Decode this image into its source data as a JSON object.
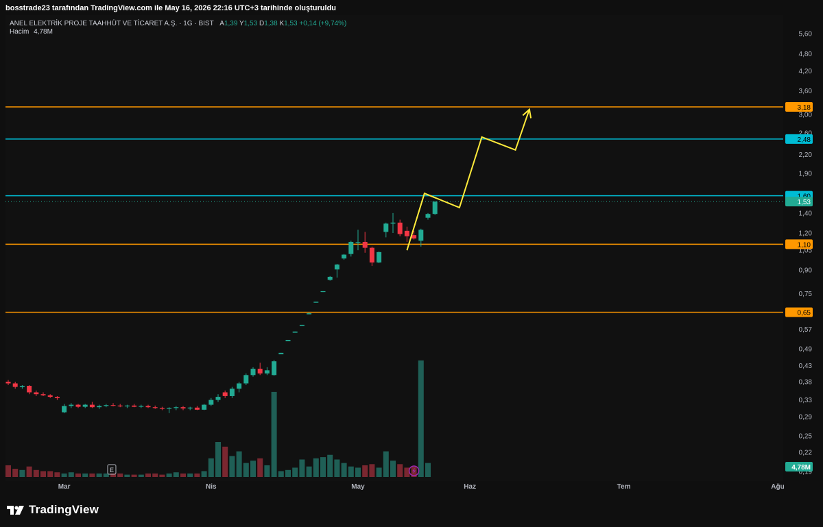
{
  "header": {
    "attribution": "bosstrade23 tarafından TradingView.com ile May 16, 2026 22:16 UTC+3 tarihinde oluşturuldu"
  },
  "legend": {
    "symbol": "ANEL ELEKTRİK PROJE TAAHHÜT VE TİCARET A.Ş. · 1G · BIST",
    "open_label": "A",
    "open": "1,39",
    "high_label": "Y",
    "high": "1,53",
    "low_label": "D",
    "low": "1,38",
    "close_label": "K",
    "close": "1,53",
    "change": "+0,14 (+9,74%)",
    "volume_label": "Hacim",
    "volume": "4,78M"
  },
  "branding": {
    "logo_text": "TradingView"
  },
  "colors": {
    "up": "#22ab94",
    "down": "#f23645",
    "orange": "#ff9800",
    "cyan": "#00bcd4",
    "path": "#ffeb3b",
    "vol_up": "#1f5f56",
    "vol_down": "#7a2730",
    "axis_text": "#b2b5be",
    "event_icon": "#9c27b0"
  },
  "chart_data": {
    "type": "candlestick",
    "symbol": "ANEL",
    "timeframe": "1G",
    "y_scale": "log",
    "ylim": [
      0.18,
      6.2
    ],
    "y_ticks": [
      "0,19",
      "0,22",
      "0,25",
      "0,29",
      "0,33",
      "0,38",
      "0,43",
      "0,49",
      "0,57",
      "0,65",
      "0,75",
      "0,90",
      "1,05",
      "1,20",
      "1,40",
      "1,60",
      "1,90",
      "2,20",
      "2,60",
      "3,00",
      "3,60",
      "4,20",
      "4,80",
      "5,60"
    ],
    "x_labels": [
      {
        "label": "Mar",
        "bar": 8
      },
      {
        "label": "Nis",
        "bar": 29
      },
      {
        "label": "May",
        "bar": 50
      },
      {
        "label": "Haz",
        "bar": 66
      },
      {
        "label": "Tem",
        "bar": 88
      },
      {
        "label": "Ağu",
        "bar": 110
      }
    ],
    "horizontal_levels": [
      {
        "value": 3.18,
        "label": "3,18",
        "color": "orange"
      },
      {
        "value": 2.48,
        "label": "2,48",
        "color": "cyan"
      },
      {
        "value": 1.6,
        "label": "1,60",
        "color": "cyan"
      },
      {
        "value": 1.1,
        "label": "1,10",
        "color": "orange"
      },
      {
        "value": 0.65,
        "label": "0,65",
        "color": "orange"
      }
    ],
    "last_price": {
      "value": 1.53,
      "label": "1,53"
    },
    "volume_badge": "4,78M",
    "candles": [
      {
        "o": 0.38,
        "h": 0.385,
        "l": 0.37,
        "c": 0.375
      },
      {
        "o": 0.375,
        "h": 0.38,
        "l": 0.36,
        "c": 0.365
      },
      {
        "o": 0.365,
        "h": 0.37,
        "l": 0.36,
        "c": 0.368
      },
      {
        "o": 0.368,
        "h": 0.37,
        "l": 0.345,
        "c": 0.35
      },
      {
        "o": 0.35,
        "h": 0.355,
        "l": 0.34,
        "c": 0.345
      },
      {
        "o": 0.345,
        "h": 0.35,
        "l": 0.34,
        "c": 0.342
      },
      {
        "o": 0.342,
        "h": 0.345,
        "l": 0.335,
        "c": 0.338
      },
      {
        "o": 0.338,
        "h": 0.34,
        "l": 0.33,
        "c": 0.335
      },
      {
        "o": 0.3,
        "h": 0.32,
        "l": 0.298,
        "c": 0.315
      },
      {
        "o": 0.315,
        "h": 0.322,
        "l": 0.31,
        "c": 0.318
      },
      {
        "o": 0.318,
        "h": 0.32,
        "l": 0.31,
        "c": 0.313
      },
      {
        "o": 0.313,
        "h": 0.32,
        "l": 0.31,
        "c": 0.318
      },
      {
        "o": 0.318,
        "h": 0.325,
        "l": 0.31,
        "c": 0.312
      },
      {
        "o": 0.312,
        "h": 0.318,
        "l": 0.308,
        "c": 0.315
      },
      {
        "o": 0.315,
        "h": 0.32,
        "l": 0.312,
        "c": 0.317
      },
      {
        "o": 0.317,
        "h": 0.322,
        "l": 0.314,
        "c": 0.316
      },
      {
        "o": 0.316,
        "h": 0.32,
        "l": 0.312,
        "c": 0.314
      },
      {
        "o": 0.314,
        "h": 0.318,
        "l": 0.31,
        "c": 0.316
      },
      {
        "o": 0.316,
        "h": 0.32,
        "l": 0.312,
        "c": 0.313
      },
      {
        "o": 0.313,
        "h": 0.318,
        "l": 0.31,
        "c": 0.315
      },
      {
        "o": 0.315,
        "h": 0.318,
        "l": 0.31,
        "c": 0.312
      },
      {
        "o": 0.312,
        "h": 0.316,
        "l": 0.308,
        "c": 0.31
      },
      {
        "o": 0.31,
        "h": 0.313,
        "l": 0.305,
        "c": 0.308
      },
      {
        "o": 0.308,
        "h": 0.312,
        "l": 0.298,
        "c": 0.31
      },
      {
        "o": 0.31,
        "h": 0.315,
        "l": 0.305,
        "c": 0.312
      },
      {
        "o": 0.312,
        "h": 0.315,
        "l": 0.305,
        "c": 0.309
      },
      {
        "o": 0.309,
        "h": 0.313,
        "l": 0.305,
        "c": 0.311
      },
      {
        "o": 0.311,
        "h": 0.315,
        "l": 0.305,
        "c": 0.306
      },
      {
        "o": 0.306,
        "h": 0.32,
        "l": 0.305,
        "c": 0.318
      },
      {
        "o": 0.318,
        "h": 0.335,
        "l": 0.315,
        "c": 0.33
      },
      {
        "o": 0.33,
        "h": 0.345,
        "l": 0.325,
        "c": 0.338
      },
      {
        "o": 0.35,
        "h": 0.355,
        "l": 0.335,
        "c": 0.34
      },
      {
        "o": 0.34,
        "h": 0.365,
        "l": 0.335,
        "c": 0.36
      },
      {
        "o": 0.36,
        "h": 0.38,
        "l": 0.35,
        "c": 0.375
      },
      {
        "o": 0.375,
        "h": 0.405,
        "l": 0.37,
        "c": 0.4
      },
      {
        "o": 0.4,
        "h": 0.425,
        "l": 0.395,
        "c": 0.42
      },
      {
        "o": 0.42,
        "h": 0.44,
        "l": 0.4,
        "c": 0.405
      },
      {
        "o": 0.405,
        "h": 0.425,
        "l": 0.4,
        "c": 0.415
      },
      {
        "o": 0.4,
        "h": 0.45,
        "l": 0.398,
        "c": 0.445
      },
      {
        "o": 0.47,
        "h": 0.475,
        "l": 0.47,
        "c": 0.475
      },
      {
        "o": 0.52,
        "h": 0.525,
        "l": 0.52,
        "c": 0.525
      },
      {
        "o": 0.555,
        "h": 0.56,
        "l": 0.555,
        "c": 0.56
      },
      {
        "o": 0.585,
        "h": 0.59,
        "l": 0.585,
        "c": 0.59
      },
      {
        "o": 0.64,
        "h": 0.65,
        "l": 0.64,
        "c": 0.645
      },
      {
        "o": 0.7,
        "h": 0.705,
        "l": 0.7,
        "c": 0.705
      },
      {
        "o": 0.76,
        "h": 0.765,
        "l": 0.76,
        "c": 0.765
      },
      {
        "o": 0.835,
        "h": 0.86,
        "l": 0.83,
        "c": 0.855
      },
      {
        "o": 0.905,
        "h": 0.945,
        "l": 0.85,
        "c": 0.94
      },
      {
        "o": 0.985,
        "h": 1.02,
        "l": 0.975,
        "c": 1.015
      },
      {
        "o": 1.02,
        "h": 1.13,
        "l": 1.0,
        "c": 1.12
      },
      {
        "o": 1.12,
        "h": 1.23,
        "l": 1.05,
        "c": 1.12
      },
      {
        "o": 1.12,
        "h": 1.21,
        "l": 1.03,
        "c": 1.07
      },
      {
        "o": 1.07,
        "h": 1.08,
        "l": 0.93,
        "c": 0.955
      },
      {
        "o": 0.955,
        "h": 1.04,
        "l": 0.95,
        "c": 1.035
      },
      {
        "o": 1.21,
        "h": 1.3,
        "l": 1.16,
        "c": 1.29
      },
      {
        "o": 1.29,
        "h": 1.4,
        "l": 1.2,
        "c": 1.3
      },
      {
        "o": 1.3,
        "h": 1.33,
        "l": 1.17,
        "c": 1.19
      },
      {
        "o": 1.22,
        "h": 1.26,
        "l": 1.12,
        "c": 1.17
      },
      {
        "o": 1.18,
        "h": 1.22,
        "l": 1.14,
        "c": 1.15
      },
      {
        "o": 1.13,
        "h": 1.24,
        "l": 1.08,
        "c": 1.23
      },
      {
        "o": 1.35,
        "h": 1.4,
        "l": 1.33,
        "c": 1.39
      },
      {
        "o": 1.39,
        "h": 1.53,
        "l": 1.38,
        "c": 1.53
      }
    ],
    "volume_relative": [
      0.1,
      0.07,
      0.06,
      0.09,
      0.06,
      0.05,
      0.05,
      0.04,
      0.03,
      0.04,
      0.03,
      0.03,
      0.03,
      0.03,
      0.03,
      0.03,
      0.03,
      0.02,
      0.02,
      0.02,
      0.03,
      0.03,
      0.02,
      0.03,
      0.04,
      0.03,
      0.03,
      0.03,
      0.05,
      0.16,
      0.3,
      0.26,
      0.18,
      0.22,
      0.12,
      0.14,
      0.16,
      0.1,
      0.73,
      0.05,
      0.06,
      0.08,
      0.15,
      0.09,
      0.16,
      0.17,
      0.19,
      0.15,
      0.12,
      0.09,
      0.08,
      0.1,
      0.11,
      0.08,
      0.22,
      0.14,
      0.11,
      0.08,
      0.09,
      1.0,
      0.12
    ],
    "projection_path": [
      {
        "bar": 57.0,
        "value": 1.05
      },
      {
        "bar": 59.5,
        "value": 1.63
      },
      {
        "bar": 64.5,
        "value": 1.46
      },
      {
        "bar": 67.7,
        "value": 2.52
      },
      {
        "bar": 72.5,
        "value": 2.28
      },
      {
        "bar": 74.5,
        "value": 3.12
      }
    ]
  }
}
